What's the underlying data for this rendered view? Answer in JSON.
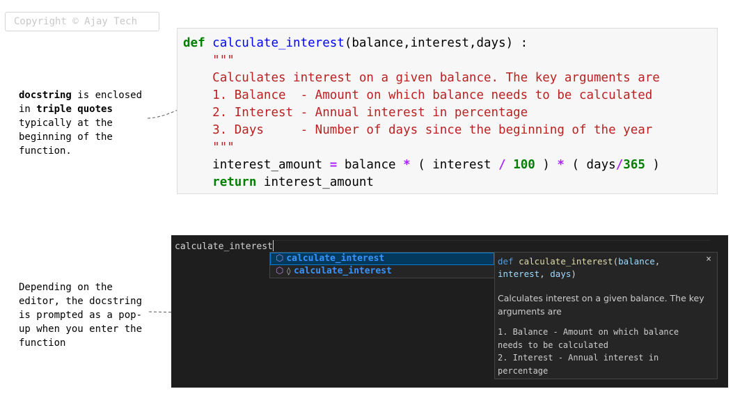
{
  "watermark": "Copyright © Ajay Tech",
  "note1": {
    "b1": "docstring",
    "t1": " is enclosed in ",
    "b2": "triple quotes",
    "t2": " typically at the beginning of the function."
  },
  "note2": "Depending on the editor, the docstring is prompted as a pop-up when you enter the function",
  "code": {
    "kw_def": "def",
    "fn_name": "calculate_interest",
    "params": "(balance,interest,days) :",
    "triple1": "\"\"\"",
    "doc1": "Calculates interest on a given balance. The key arguments are",
    "doc2": "1. Balance  - Amount on which balance needs to be calculated",
    "doc3": "2. Interest - Annual interest in percentage",
    "doc4": "3. Days     - Number of days since the beginning of the year",
    "triple2": "\"\"\"",
    "l_a": "interest_amount ",
    "l_eq": "=",
    "l_b": " balance ",
    "l_m1": "*",
    "l_c": " ( interest ",
    "l_div": "/",
    "l_sp": " ",
    "l_100": "100",
    "l_d": " ) ",
    "l_m2": "*",
    "l_e": " ( days",
    "l_div2": "/",
    "l_365": "365",
    "l_f": " )",
    "kw_return": "return",
    "ret_val": " interest_amount"
  },
  "editor": {
    "typed": "calculate_interest",
    "suggest": [
      {
        "label": "calculate_interest",
        "icon": "cube-icon"
      },
      {
        "label": "calculate_interest",
        "icon": "cube-icon",
        "extra": "◊"
      }
    ],
    "details": {
      "kw": "def",
      "fn": "calculate_interest",
      "open": "(",
      "p1": "balance",
      "comma1": ",",
      "p2": "interest",
      "comma2": ", ",
      "p3": "days",
      "close": ")",
      "close_icon": "×",
      "desc": "Calculates interest on a given balance. The key arguments are",
      "item1": "1. Balance  - Amount on which balance needs to be calculated",
      "item2": "2. Interest - Annual interest in percentage"
    }
  },
  "colors": {
    "keyword": "#008000",
    "function": "#0000ff",
    "docstring": "#ba2121",
    "operator": "#aa22ff",
    "editor_bg": "#1e1e1e"
  }
}
